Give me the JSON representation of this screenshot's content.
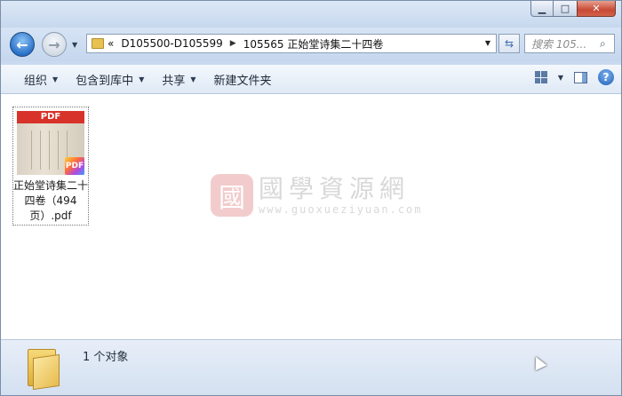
{
  "window": {
    "controls": {
      "minimize": "▁",
      "maximize": "□",
      "close": "✕"
    }
  },
  "nav": {
    "back_glyph": "←",
    "forward_glyph": "→",
    "dropdown_glyph": "▼"
  },
  "address": {
    "overflow": "«",
    "crumbs": [
      "D105500-D105599",
      "105565 正始堂诗集二十四卷"
    ],
    "separator": "▶",
    "dropdown_glyph": "▼"
  },
  "refresh_glyph": "⇆",
  "search": {
    "placeholder": "搜索 105...",
    "icon_glyph": "⌕"
  },
  "toolbar": {
    "organize": "组织",
    "include_library": "包含到库中",
    "share": "共享",
    "new_folder": "新建文件夹",
    "arrow_glyph": "▼",
    "help_glyph": "?"
  },
  "files": [
    {
      "name": "正始堂诗集二十四卷（494页）.pdf",
      "thumb_label": "PDF",
      "badge": "PDF"
    }
  ],
  "watermark": {
    "seal": "國",
    "text": "國學資源網",
    "url": "www.guoxueziyuan.com"
  },
  "status": {
    "text": "1 个对象"
  },
  "colors": {
    "accent": "#2a71c9",
    "close": "#c74a35",
    "pdf_red": "#d8332a"
  }
}
